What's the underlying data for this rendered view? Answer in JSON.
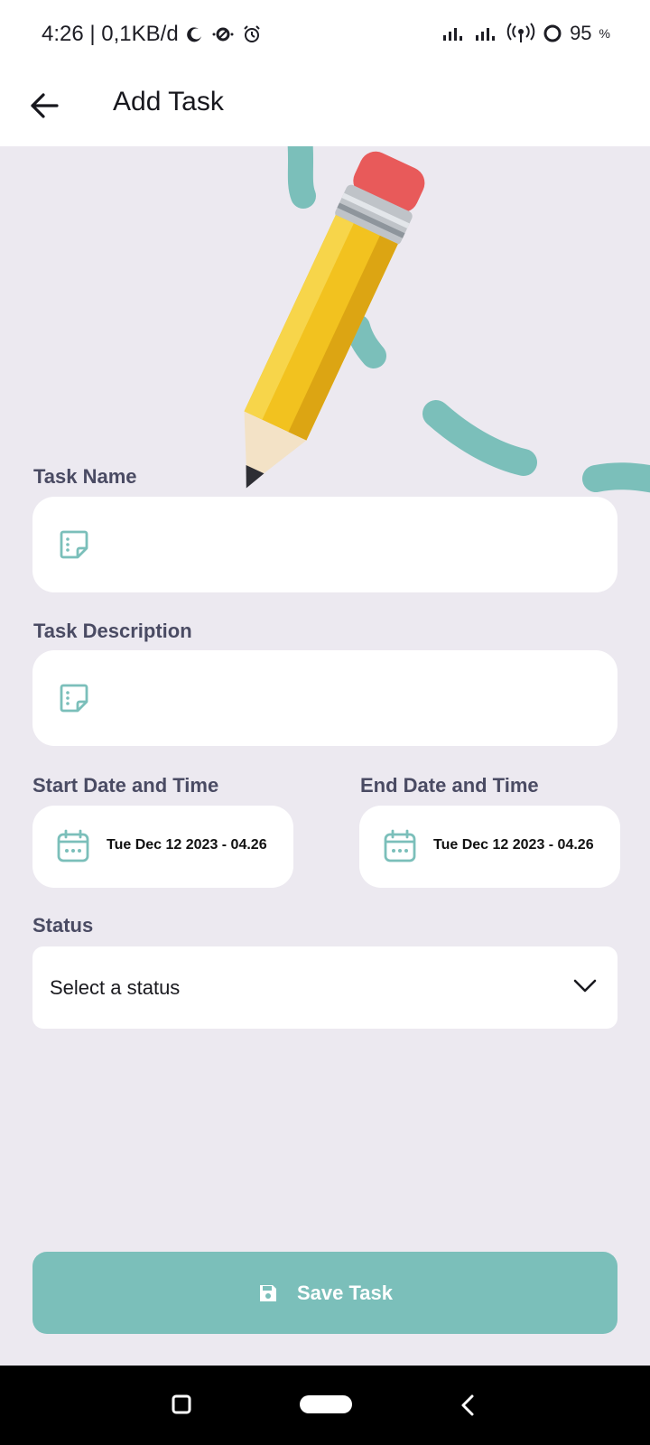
{
  "status_bar": {
    "time_and_speed": "4:26 | 0,1KB/d",
    "battery": "95",
    "battery_unit": "%"
  },
  "app_bar": {
    "title": "Add Task",
    "back_icon": "arrow-left-icon"
  },
  "form": {
    "task_name": {
      "label": "Task Name",
      "value": "",
      "icon": "note-icon"
    },
    "task_description": {
      "label": "Task Description",
      "value": "",
      "icon": "note-icon"
    },
    "start": {
      "label": "Start Date and Time",
      "value": "Tue Dec 12 2023 - 04.26",
      "icon": "calendar-icon"
    },
    "end": {
      "label": "End Date and Time",
      "value": "Tue Dec 12 2023 - 04.26",
      "icon": "calendar-icon"
    },
    "status": {
      "label": "Status",
      "selected": "Select a status",
      "icon": "chevron-down-icon"
    }
  },
  "save_button": {
    "label": "Save Task",
    "icon": "save-icon"
  },
  "colors": {
    "accent": "#7bbfba",
    "background": "#ece9f0",
    "label": "#4a4b63",
    "pencil_body": "#f2c21f",
    "eraser": "#e85a5a"
  },
  "nav_bar": {
    "icons": [
      "recents-icon",
      "home-pill-icon",
      "back-icon"
    ]
  }
}
